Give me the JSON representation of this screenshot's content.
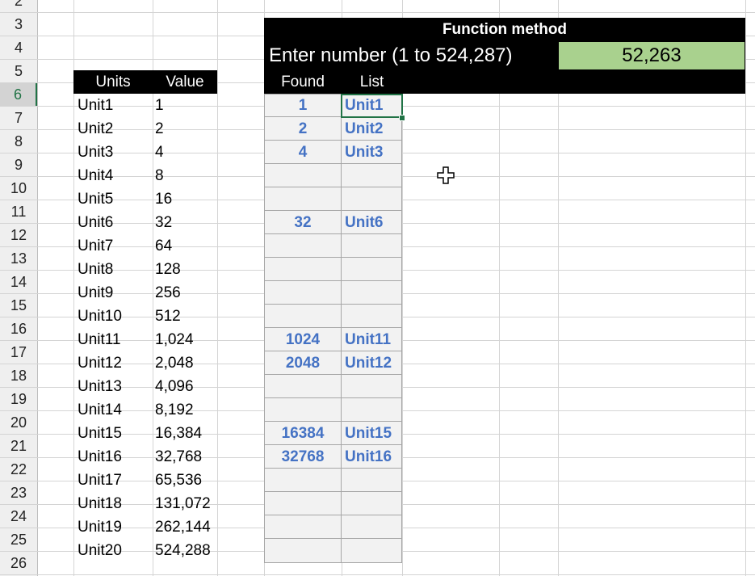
{
  "rows": [
    "2",
    "3",
    "4",
    "5",
    "6",
    "7",
    "8",
    "9",
    "10",
    "11",
    "12",
    "13",
    "14",
    "15",
    "16",
    "17",
    "18",
    "19",
    "20",
    "21",
    "22",
    "23",
    "24",
    "25",
    "26"
  ],
  "active_row": "6",
  "units_table": {
    "headers": {
      "units": "Units",
      "value": "Value"
    },
    "rows": [
      {
        "unit": "Unit1",
        "value": "1"
      },
      {
        "unit": "Unit2",
        "value": "2"
      },
      {
        "unit": "Unit3",
        "value": "4"
      },
      {
        "unit": "Unit4",
        "value": "8"
      },
      {
        "unit": "Unit5",
        "value": "16"
      },
      {
        "unit": "Unit6",
        "value": "32"
      },
      {
        "unit": "Unit7",
        "value": "64"
      },
      {
        "unit": "Unit8",
        "value": "128"
      },
      {
        "unit": "Unit9",
        "value": "256"
      },
      {
        "unit": "Unit10",
        "value": "512"
      },
      {
        "unit": "Unit11",
        "value": "1,024"
      },
      {
        "unit": "Unit12",
        "value": "2,048"
      },
      {
        "unit": "Unit13",
        "value": "4,096"
      },
      {
        "unit": "Unit14",
        "value": "8,192"
      },
      {
        "unit": "Unit15",
        "value": "16,384"
      },
      {
        "unit": "Unit16",
        "value": "32,768"
      },
      {
        "unit": "Unit17",
        "value": "65,536"
      },
      {
        "unit": "Unit18",
        "value": "131,072"
      },
      {
        "unit": "Unit19",
        "value": "262,144"
      },
      {
        "unit": "Unit20",
        "value": "524,288"
      }
    ]
  },
  "function_method": {
    "title": "Function method",
    "prompt": "Enter number (1 to 524,287)",
    "input_value": "52,263",
    "input_color": "#a9d18e",
    "headers": {
      "found": "Found",
      "list": "List"
    },
    "results": [
      {
        "found": "1",
        "list": "Unit1"
      },
      {
        "found": "2",
        "list": "Unit2"
      },
      {
        "found": "4",
        "list": "Unit3"
      },
      {
        "found": "",
        "list": ""
      },
      {
        "found": "",
        "list": ""
      },
      {
        "found": "32",
        "list": "Unit6"
      },
      {
        "found": "",
        "list": ""
      },
      {
        "found": "",
        "list": ""
      },
      {
        "found": "",
        "list": ""
      },
      {
        "found": "",
        "list": ""
      },
      {
        "found": "1024",
        "list": "Unit11"
      },
      {
        "found": "2048",
        "list": "Unit12"
      },
      {
        "found": "",
        "list": ""
      },
      {
        "found": "",
        "list": ""
      },
      {
        "found": "16384",
        "list": "Unit15"
      },
      {
        "found": "32768",
        "list": "Unit16"
      },
      {
        "found": "",
        "list": ""
      },
      {
        "found": "",
        "list": ""
      },
      {
        "found": "",
        "list": ""
      },
      {
        "found": "",
        "list": ""
      }
    ],
    "result_color": "#4472c4"
  },
  "cursor_icon": "cell-cross-cursor-icon"
}
